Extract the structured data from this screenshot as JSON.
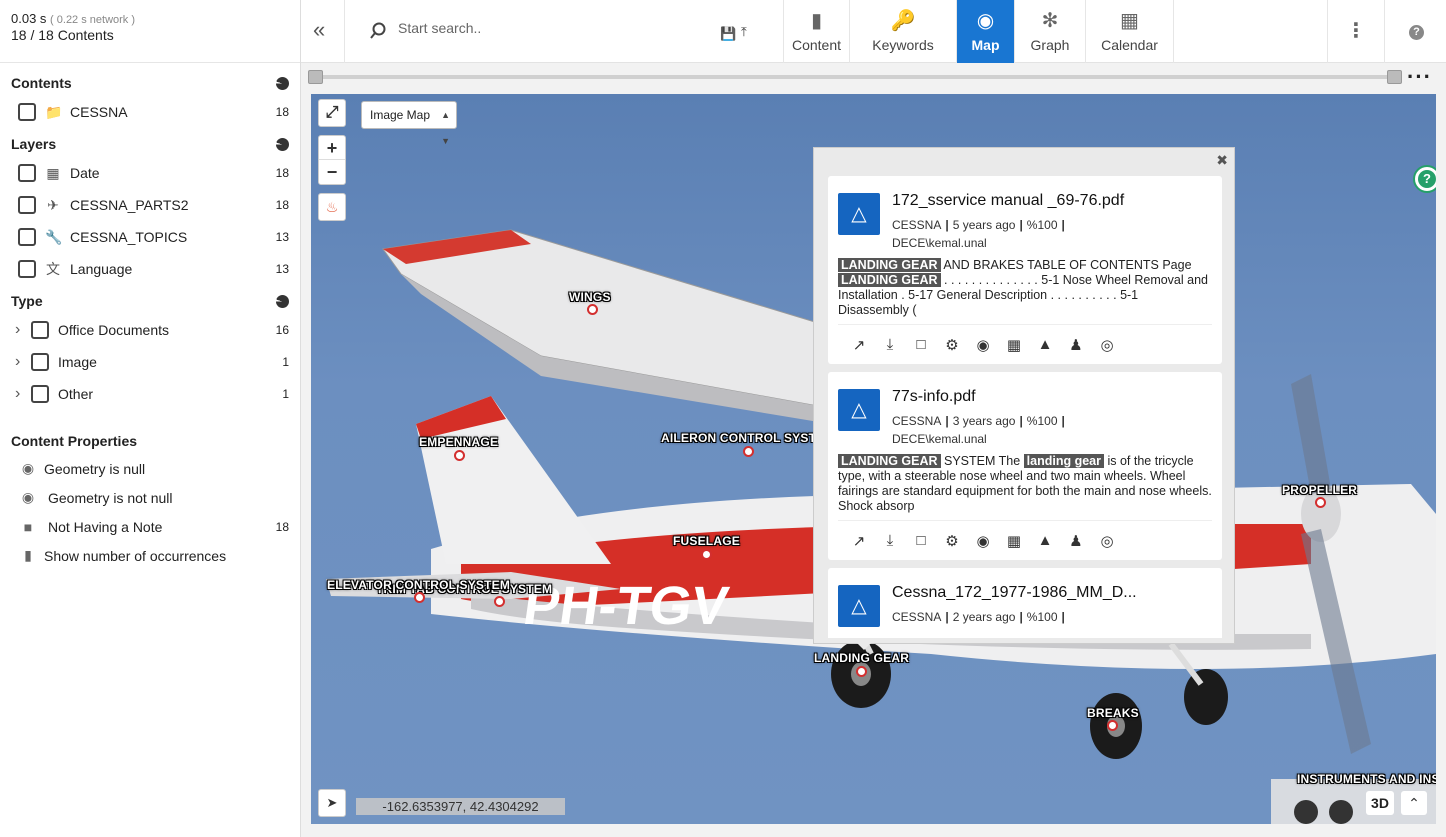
{
  "stats": {
    "time": "0.03 s",
    "network": "( 0.22 s network )",
    "contents": "18 / 18 Contents"
  },
  "sidebar": {
    "contents": {
      "title": "Contents",
      "items": [
        {
          "label": "CESSNA",
          "count": "18",
          "icon": "folder-icon"
        }
      ]
    },
    "layers": {
      "title": "Layers",
      "items": [
        {
          "label": "Date",
          "count": "18",
          "icon": "calendar-icon"
        },
        {
          "label": "CESSNA_PARTS2",
          "count": "18",
          "icon": "airplane-icon"
        },
        {
          "label": "CESSNA_TOPICS",
          "count": "13",
          "icon": "wrench-icon"
        },
        {
          "label": "Language",
          "count": "13",
          "icon": "translate-icon"
        }
      ]
    },
    "type": {
      "title": "Type",
      "items": [
        {
          "label": "Office Documents",
          "count": "16"
        },
        {
          "label": "Image",
          "count": "1"
        },
        {
          "label": "Other",
          "count": "1"
        }
      ]
    },
    "properties": {
      "title": "Content Properties",
      "items": [
        {
          "label": "Geometry is null",
          "count": ""
        },
        {
          "label": "Geometry is not null",
          "count": ""
        },
        {
          "label": "Not Having a Note",
          "count": "18"
        },
        {
          "label": "Show number of occurrences",
          "count": ""
        }
      ]
    }
  },
  "search": {
    "placeholder": "Start search.."
  },
  "tabs": [
    {
      "label": "Content",
      "icon": "book-icon"
    },
    {
      "label": "Keywords",
      "icon": "key-icon"
    },
    {
      "label": "Map",
      "icon": "map-pin-icon",
      "active": true
    },
    {
      "label": "Graph",
      "icon": "graph-icon"
    },
    {
      "label": "Calendar",
      "icon": "calendar-icon"
    }
  ],
  "map": {
    "layer_select": "Image Map",
    "coordinates": "-162.6353977, 42.4304292",
    "button_3d": "3D",
    "labels": [
      "WINGS",
      "EMPENNAGE",
      "AILERON CONTROL SYST",
      "FUSELAGE",
      "ELEVATOR CONTROL SYSTEM",
      "TRIM TAB CONTROL SYSTEM",
      "LANDING GEAR",
      "BREAKS",
      "PROPELLER",
      "INSTRUMENTS AND INS"
    ],
    "aircraft_registration": "PH-TGV"
  },
  "results": [
    {
      "title": "172_sservice manual _69-76.pdf",
      "source": "CESSNA",
      "age": "5 years ago",
      "score": "%100",
      "user": "DECE\\kemal.unal",
      "hl1": "LANDING GEAR",
      "text1": " AND BRAKES TABLE OF CONTENTS Page ",
      "hl2": "LANDING GEAR",
      "text2": " . . . . . . . . . . . . . . 5-1 Nose Wheel Removal and Installation . 5-17 General Description . . . . . . . . . . 5-1 Disassembly ("
    },
    {
      "title": "77s-info.pdf",
      "source": "CESSNA",
      "age": "3 years ago",
      "score": "%100",
      "user": "DECE\\kemal.unal",
      "hl1": "LANDING GEAR",
      "text1": " SYSTEM The ",
      "hl2": "landing gear",
      "text2": " is of the tricycle type, with a steerable nose wheel and two main wheels. Wheel fairings are standard equipment for both the main and nose wheels. Shock absorp"
    },
    {
      "title": "Cessna_172_1977-1986_MM_D...",
      "source": "CESSNA",
      "age": "2 years ago",
      "score": "%100"
    }
  ]
}
